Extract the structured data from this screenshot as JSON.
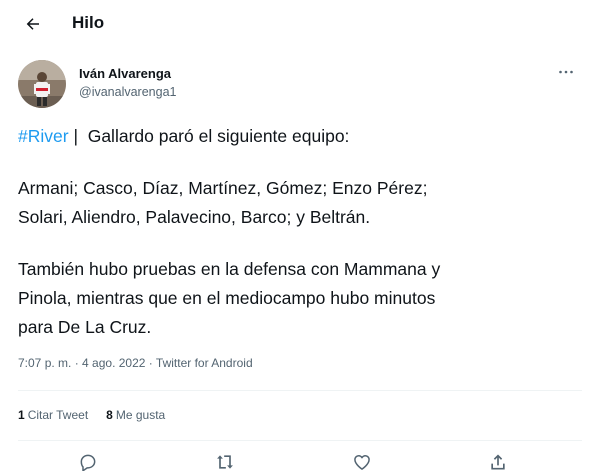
{
  "header": {
    "back_icon": "arrow-left-icon",
    "title": "Hilo"
  },
  "author": {
    "name": "Iván Alvarenga",
    "handle": "@ivanalvarenga1",
    "more_icon": "more-horizontal-icon"
  },
  "tweet": {
    "hashtag": "#River",
    "line1_rest": " |  Gallardo paró el siguiente equipo:",
    "line2": "Armani; Casco, Díaz, Martínez, Gómez; Enzo Pérez;",
    "line3": "Solari, Aliendro, Palavecino, Barco; y Beltrán.",
    "line4": "También hubo pruebas en la defensa con Mammana y",
    "line5": "Pinola, mientras que en el mediocampo hubo minutos",
    "line6": "para De La Cruz."
  },
  "meta": {
    "time": "7:07 p. m.",
    "separator1": " · ",
    "date": "4 ago. 2022",
    "separator2": " · ",
    "source": "Twitter for Android"
  },
  "stats": {
    "quotes_count": "1",
    "quotes_label": "Citar Tweet",
    "likes_count": "8",
    "likes_label": "Me gusta"
  },
  "actions": {
    "reply_icon": "reply-icon",
    "retweet_icon": "retweet-icon",
    "like_icon": "heart-icon",
    "share_icon": "share-icon"
  },
  "colors": {
    "link": "#1d9bf0",
    "text": "#0f1419",
    "secondary": "#536471"
  }
}
